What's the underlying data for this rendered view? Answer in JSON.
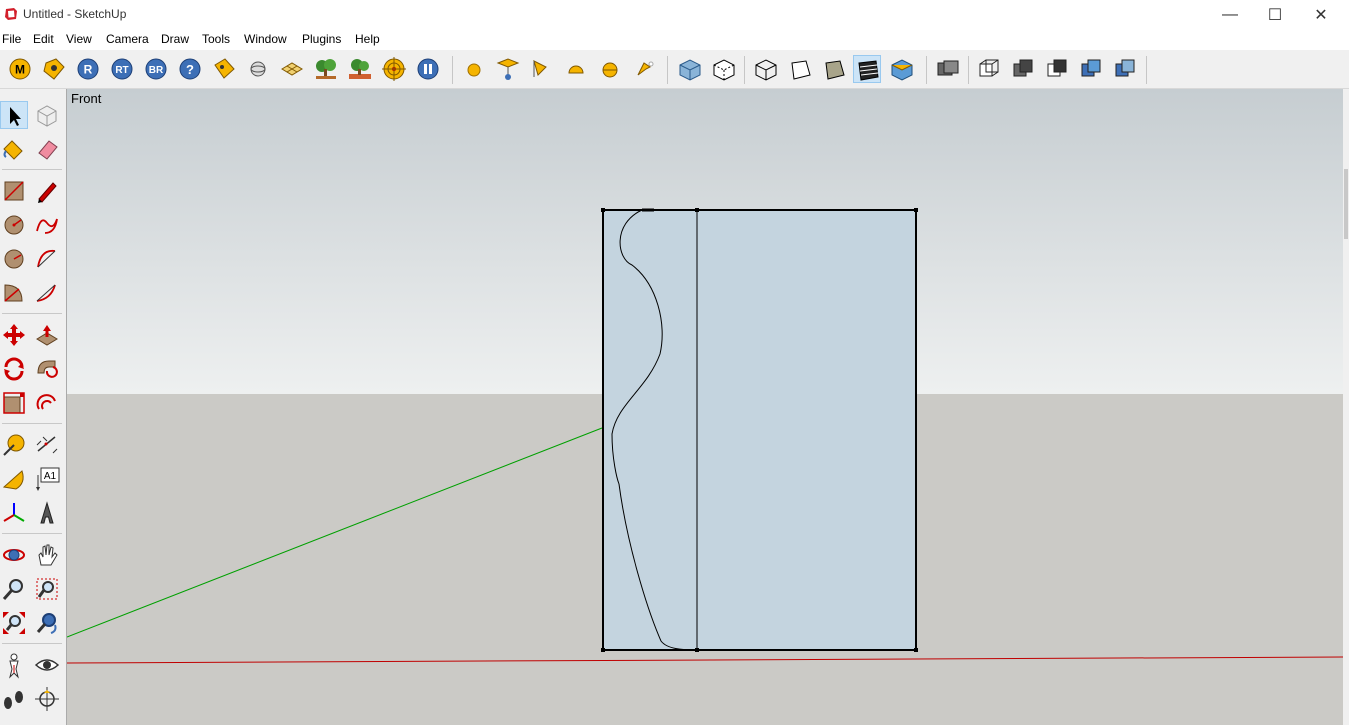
{
  "window": {
    "title": "Untitled - SketchUp",
    "controls": {
      "minimize": "—",
      "maximize": "☐",
      "close": "✕"
    }
  },
  "menu": [
    "File",
    "Edit",
    "View",
    "Camera",
    "Draw",
    "Tools",
    "Window",
    "Plugins",
    "Help"
  ],
  "viewport": {
    "scene_label": "Front"
  },
  "colors": {
    "sky": "#c9d0d4",
    "ground": "#cbcac6",
    "face": "#c4d4df",
    "red_axis": "#c00000",
    "green_axis": "#00a000",
    "selected_tool": "#cce4f7"
  },
  "toolbar_icons": [
    "m-plugin-icon",
    "tag-plugin-icon",
    "r-plugin-icon",
    "rt-plugin-icon",
    "br-plugin-icon",
    "help-plugin-icon",
    "label-plugin-icon",
    "sphere-plugin-icon",
    "grid-plugin-icon",
    "tree-plugin-icon",
    "tree-placer-icon",
    "target-icon",
    "pause-icon",
    "sun-icon",
    "lamp-icon",
    "spotlight-icon",
    "dome-icon",
    "half-sphere-icon",
    "light-arrow-icon",
    "xray-style-icon",
    "back-edges-style-icon",
    "wireframe-style-icon",
    "hidden-line-style-icon",
    "shaded-style-icon",
    "shaded-textures-style-icon",
    "monochrome-style-icon",
    "section-plane-icon",
    "iso-view-icon",
    "top-view-icon",
    "front-view-icon",
    "right-view-icon",
    "back-view-icon"
  ],
  "left_tools": [
    "select-tool-icon",
    "make-component-icon",
    "paint-bucket-icon",
    "eraser-icon",
    "rectangle-tool-icon",
    "pencil-tool-icon",
    "circle-tool-icon",
    "freehand-tool-icon",
    "polygon-tool-icon",
    "arc-tool-icon",
    "pie-tool-icon",
    "two-point-arc-icon",
    "move-tool-icon",
    "push-pull-icon",
    "rotate-tool-icon",
    "follow-me-icon",
    "scale-tool-icon",
    "offset-tool-icon",
    "tape-measure-icon",
    "dimension-tool-icon",
    "protractor-icon",
    "text-tool-icon",
    "axes-tool-icon",
    "3d-text-icon",
    "orbit-tool-icon",
    "pan-tool-icon",
    "zoom-tool-icon",
    "zoom-window-icon",
    "zoom-extents-icon",
    "previous-view-icon",
    "position-camera-icon",
    "look-around-icon",
    "walk-tool-icon",
    "section-tool-icon"
  ],
  "left_tool_text": {
    "text_tool": "A1"
  }
}
